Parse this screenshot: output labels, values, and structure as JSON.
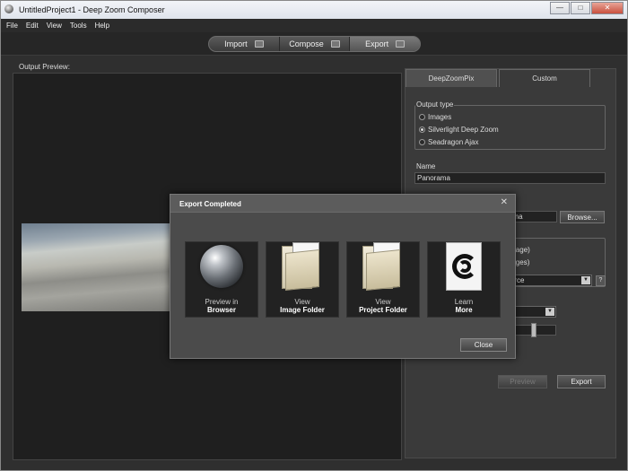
{
  "window": {
    "title": "UntitledProject1 - Deep Zoom Composer",
    "controls": [
      "—",
      "□",
      "✕"
    ]
  },
  "menu": [
    "File",
    "Edit",
    "View",
    "Tools",
    "Help"
  ],
  "modes": [
    "Import",
    "Compose",
    "Export"
  ],
  "preview": {
    "label": "Output Preview:"
  },
  "panel": {
    "tabs": [
      "DeepZoomPix",
      "Custom"
    ],
    "output_type_label": "Output type",
    "output_types": [
      "Images",
      "Silverlight Deep Zoom",
      "Seadragon Ajax"
    ],
    "selected_output_type": "Silverlight Deep Zoom",
    "name_label": "Name",
    "name_value": "Panorama",
    "location_value": "ama",
    "browse_label": "Browse...",
    "export_opt1": "ngle image)",
    "export_opt2": "ple images)",
    "template_value": "c + Source",
    "help_label": "?",
    "preview_label": "Preview",
    "export_label": "Export"
  },
  "dialog": {
    "title": "Export Completed",
    "close_x": "✕",
    "tiles": [
      {
        "line1": "Preview in",
        "line2": "Browser",
        "icon": "globe-icon"
      },
      {
        "line1": "View",
        "line2": "Image Folder",
        "icon": "image-folder-icon"
      },
      {
        "line1": "View",
        "line2": "Project Folder",
        "icon": "project-folder-icon"
      },
      {
        "line1": "Learn",
        "line2": "More",
        "icon": "learn-more-icon"
      }
    ],
    "close_label": "Close"
  }
}
